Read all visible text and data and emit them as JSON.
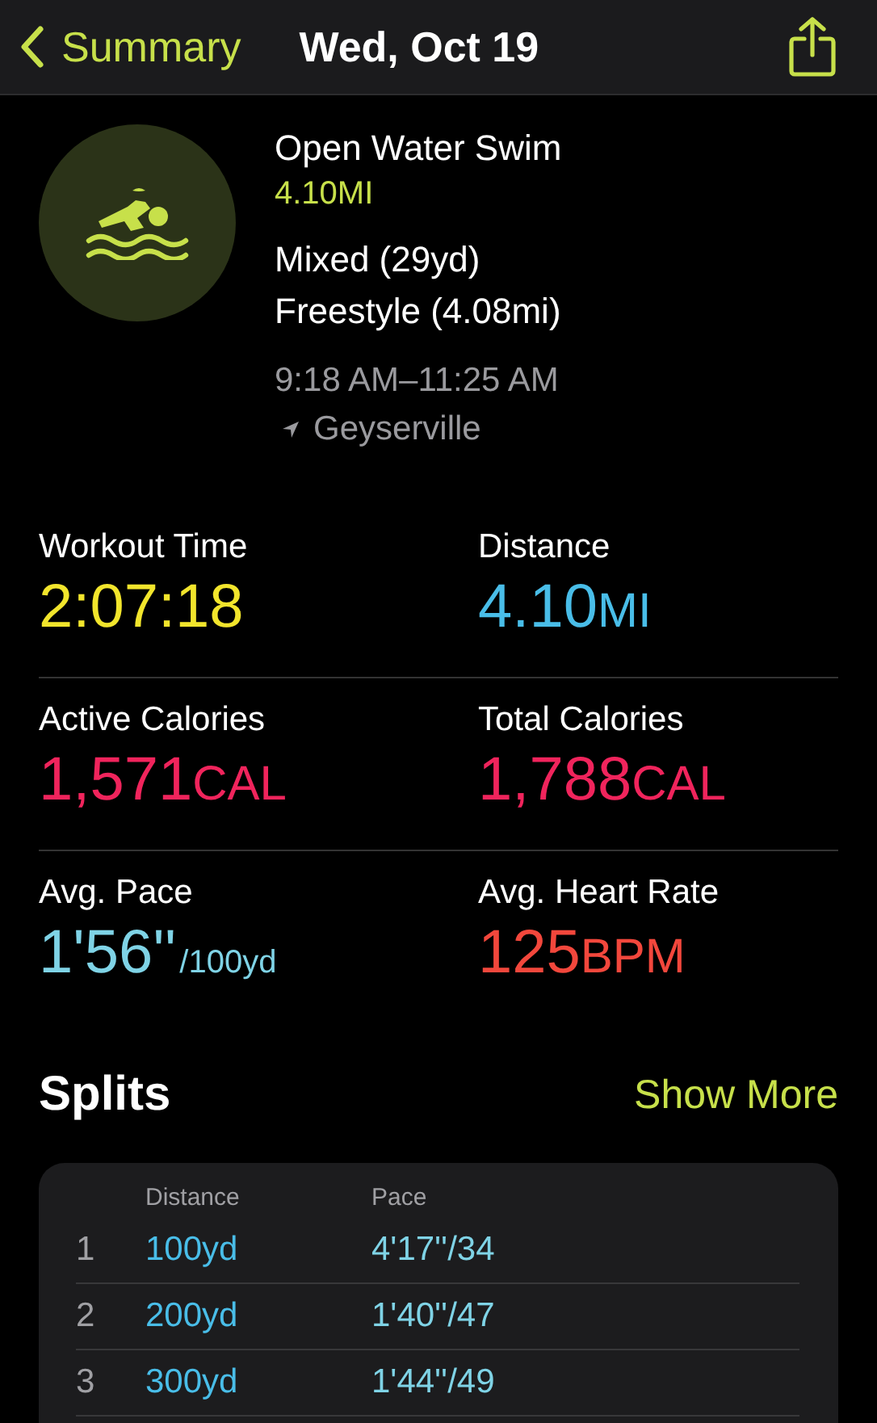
{
  "header": {
    "back_label": "Summary",
    "title": "Wed, Oct 19"
  },
  "workout": {
    "name": "Open Water Swim",
    "distance": "4.10MI",
    "strokes": [
      "Mixed (29yd)",
      "Freestyle (4.08mi)"
    ],
    "time_range": "9:18 AM–11:25 AM",
    "location": "Geyserville"
  },
  "metrics": [
    {
      "label": "Workout Time",
      "value": "2:07:18",
      "color": "#f2e52c"
    },
    {
      "label": "Distance",
      "value": "4.10",
      "unit": "MI",
      "unit_small": false,
      "color": "#49bde8"
    },
    {
      "label": "Active Calories",
      "value": "1,571",
      "unit": "CAL",
      "unit_small": false,
      "color": "#f0245c"
    },
    {
      "label": "Total Calories",
      "value": "1,788",
      "unit": "CAL",
      "unit_small": false,
      "color": "#f0245c"
    },
    {
      "label": "Avg. Pace",
      "value": "1'56''",
      "unit": "/100yd",
      "unit_small": true,
      "color": "#7fd3e6"
    },
    {
      "label": "Avg. Heart Rate",
      "value": "125",
      "unit": "BPM",
      "unit_small": false,
      "color": "#f2473c"
    }
  ],
  "splits": {
    "title": "Splits",
    "show_more": "Show More",
    "columns": [
      "Distance",
      "Pace"
    ],
    "rows": [
      {
        "index": "1",
        "distance": "100yd",
        "pace": "4'17''/34"
      },
      {
        "index": "2",
        "distance": "200yd",
        "pace": "1'40''/47"
      },
      {
        "index": "3",
        "distance": "300yd",
        "pace": "1'44''/49"
      }
    ]
  }
}
